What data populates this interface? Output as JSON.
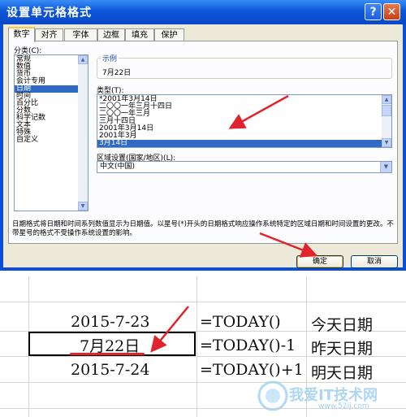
{
  "dialog": {
    "title": "设置单元格格式",
    "help_glyph": "?",
    "close_glyph": "✕",
    "tabs": [
      "数字",
      "对齐",
      "字体",
      "边框",
      "填充",
      "保护"
    ],
    "category_label": "分类(C):",
    "categories": [
      "常规",
      "数值",
      "货币",
      "会计专用",
      "日期",
      "时间",
      "百分比",
      "分数",
      "科学记数",
      "文本",
      "特殊",
      "自定义"
    ],
    "selected_category": "日期",
    "sample_label": "示例",
    "sample_value": "7月22日",
    "type_label": "类型(T):",
    "types": [
      "*2001年3月14日",
      "二〇〇一年三月十四日",
      "二〇〇一年三月",
      "三月十四日",
      "2001年3月14日",
      "2001年3月",
      "3月14日"
    ],
    "selected_type": "3月14日",
    "locale_label": "区域设置(国家/地区)(L):",
    "locale_value": "中文(中国)",
    "description": "日期格式将日期和时间系列数值显示为日期值。以星号(*)开头的日期格式响应操作系统特定的区域日期和时间设置的更改。不带星号的格式不受操作系统设置的影响。",
    "ok_label": "确定",
    "cancel_label": "取消"
  },
  "sheet": {
    "rows": [
      {
        "value": "2015-7-23",
        "formula": "=TODAY()",
        "note": "今天日期"
      },
      {
        "value": "7月22日",
        "formula": "=TODAY()-1",
        "note": "昨天日期"
      },
      {
        "value": "2015-7-24",
        "formula": "=TODAY()+1",
        "note": "明天日期"
      }
    ]
  },
  "watermark": {
    "brand": "我爱IT技术网",
    "url": "www.52ij.com"
  },
  "colors": {
    "annotation_red": "#e0232c",
    "selection_blue": "#316ac5",
    "xp_title_blue": "#0b56d8"
  }
}
